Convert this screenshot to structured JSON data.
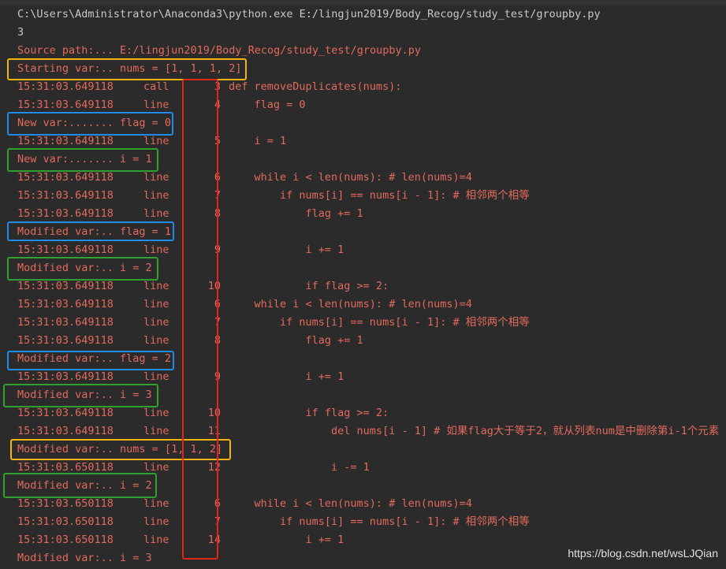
{
  "header": {
    "command": "C:\\Users\\Administrator\\Anaconda3\\python.exe E:/lingjun2019/Body_Recog/study_test/groupby.py",
    "output": "3"
  },
  "trace": {
    "source_path": "Source path:... E:/lingjun2019/Body_Recog/study_test/groupby.py",
    "starting_var": "Starting var:.. nums = [1, 1, 1, 2]"
  },
  "rows": [
    {
      "kind": "event",
      "ts": "15:31:03.649118",
      "ev": "call",
      "num": "3",
      "src": "def removeDuplicates(nums):"
    },
    {
      "kind": "event",
      "ts": "15:31:03.649118",
      "ev": "line",
      "num": "4",
      "src": "    flag = 0"
    },
    {
      "kind": "var",
      "text": "New var:....... flag = 0"
    },
    {
      "kind": "event",
      "ts": "15:31:03.649118",
      "ev": "line",
      "num": "5",
      "src": "    i = 1"
    },
    {
      "kind": "var",
      "text": "New var:....... i = 1"
    },
    {
      "kind": "event",
      "ts": "15:31:03.649118",
      "ev": "line",
      "num": "6",
      "src": "    while i < len(nums): # len(nums)=4"
    },
    {
      "kind": "event",
      "ts": "15:31:03.649118",
      "ev": "line",
      "num": "7",
      "src": "        if nums[i] == nums[i - 1]: # 相邻两个相等"
    },
    {
      "kind": "event",
      "ts": "15:31:03.649118",
      "ev": "line",
      "num": "8",
      "src": "            flag += 1"
    },
    {
      "kind": "var",
      "text": "Modified var:.. flag = 1"
    },
    {
      "kind": "event",
      "ts": "15:31:03.649118",
      "ev": "line",
      "num": "9",
      "src": "            i += 1"
    },
    {
      "kind": "var",
      "text": "Modified var:.. i = 2"
    },
    {
      "kind": "event",
      "ts": "15:31:03.649118",
      "ev": "line",
      "num": "10",
      "src": "            if flag >= 2:"
    },
    {
      "kind": "event",
      "ts": "15:31:03.649118",
      "ev": "line",
      "num": "6",
      "src": "    while i < len(nums): # len(nums)=4"
    },
    {
      "kind": "event",
      "ts": "15:31:03.649118",
      "ev": "line",
      "num": "7",
      "src": "        if nums[i] == nums[i - 1]: # 相邻两个相等"
    },
    {
      "kind": "event",
      "ts": "15:31:03.649118",
      "ev": "line",
      "num": "8",
      "src": "            flag += 1"
    },
    {
      "kind": "var",
      "text": "Modified var:.. flag = 2"
    },
    {
      "kind": "event",
      "ts": "15:31:03.649118",
      "ev": "line",
      "num": "9",
      "src": "            i += 1"
    },
    {
      "kind": "var",
      "text": "Modified var:.. i = 3"
    },
    {
      "kind": "event",
      "ts": "15:31:03.649118",
      "ev": "line",
      "num": "10",
      "src": "            if flag >= 2:"
    },
    {
      "kind": "event",
      "ts": "15:31:03.649118",
      "ev": "line",
      "num": "11",
      "src": "                del nums[i - 1] # 如果flag大于等于2，就从列表num是中删除第i-1个元素"
    },
    {
      "kind": "var",
      "text": "Modified var:.. nums = [1, 1, 2]"
    },
    {
      "kind": "event",
      "ts": "15:31:03.650118",
      "ev": "line",
      "num": "12",
      "src": "                i -= 1"
    },
    {
      "kind": "var",
      "text": "Modified var:.. i = 2"
    },
    {
      "kind": "event",
      "ts": "15:31:03.650118",
      "ev": "line",
      "num": "6",
      "src": "    while i < len(nums): # len(nums)=4"
    },
    {
      "kind": "event",
      "ts": "15:31:03.650118",
      "ev": "line",
      "num": "7",
      "src": "        if nums[i] == nums[i - 1]: # 相邻两个相等"
    },
    {
      "kind": "event",
      "ts": "15:31:03.650118",
      "ev": "line",
      "num": "14",
      "src": "            i += 1"
    },
    {
      "kind": "var",
      "text": "Modified var:.. i = 3"
    }
  ],
  "watermark": "https://blog.csdn.net/wsLJQian",
  "colors": {
    "background": "#2b2b2b",
    "trace_text": "#e36a5b",
    "plain_text": "#c8c8c8",
    "orange_box": "#f5b30f",
    "blue_box": "#1f8ce6",
    "green_box": "#2ea12e",
    "red_box": "#e3241c"
  }
}
